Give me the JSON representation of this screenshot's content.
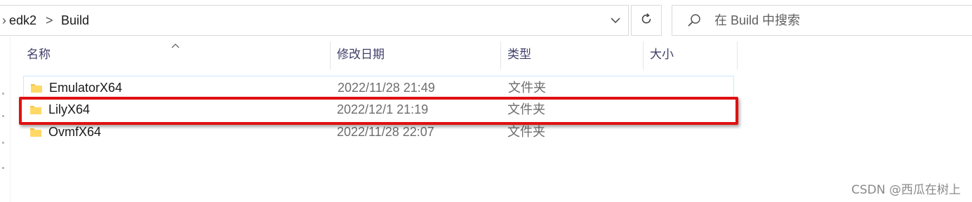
{
  "address_bar": {
    "crumbs": [
      "edk2",
      "Build"
    ],
    "separator": ">"
  },
  "search": {
    "placeholder": "在 Build 中搜索"
  },
  "columns": {
    "name": "名称",
    "date_modified": "修改日期",
    "type": "类型",
    "size": "大小"
  },
  "files": [
    {
      "name": "EmulatorX64",
      "date": "2022/11/28 21:49",
      "type": "文件夹"
    },
    {
      "name": "LilyX64",
      "date": "2022/12/1 21:19",
      "type": "文件夹"
    },
    {
      "name": "OvmfX64",
      "date": "2022/11/28 22:07",
      "type": "文件夹"
    }
  ],
  "highlighted_file": "LilyX64",
  "watermark": "CSDN @西瓜在树上",
  "icons": {
    "folder": "folder-icon",
    "refresh": "refresh-icon",
    "search": "search-icon",
    "dropdown": "chevron-down-icon",
    "sort": "sort-caret-icon"
  },
  "colors": {
    "highlight_border": "#e01010",
    "folder_fill": "#f6c445",
    "selection_border": "#cce8ff"
  }
}
